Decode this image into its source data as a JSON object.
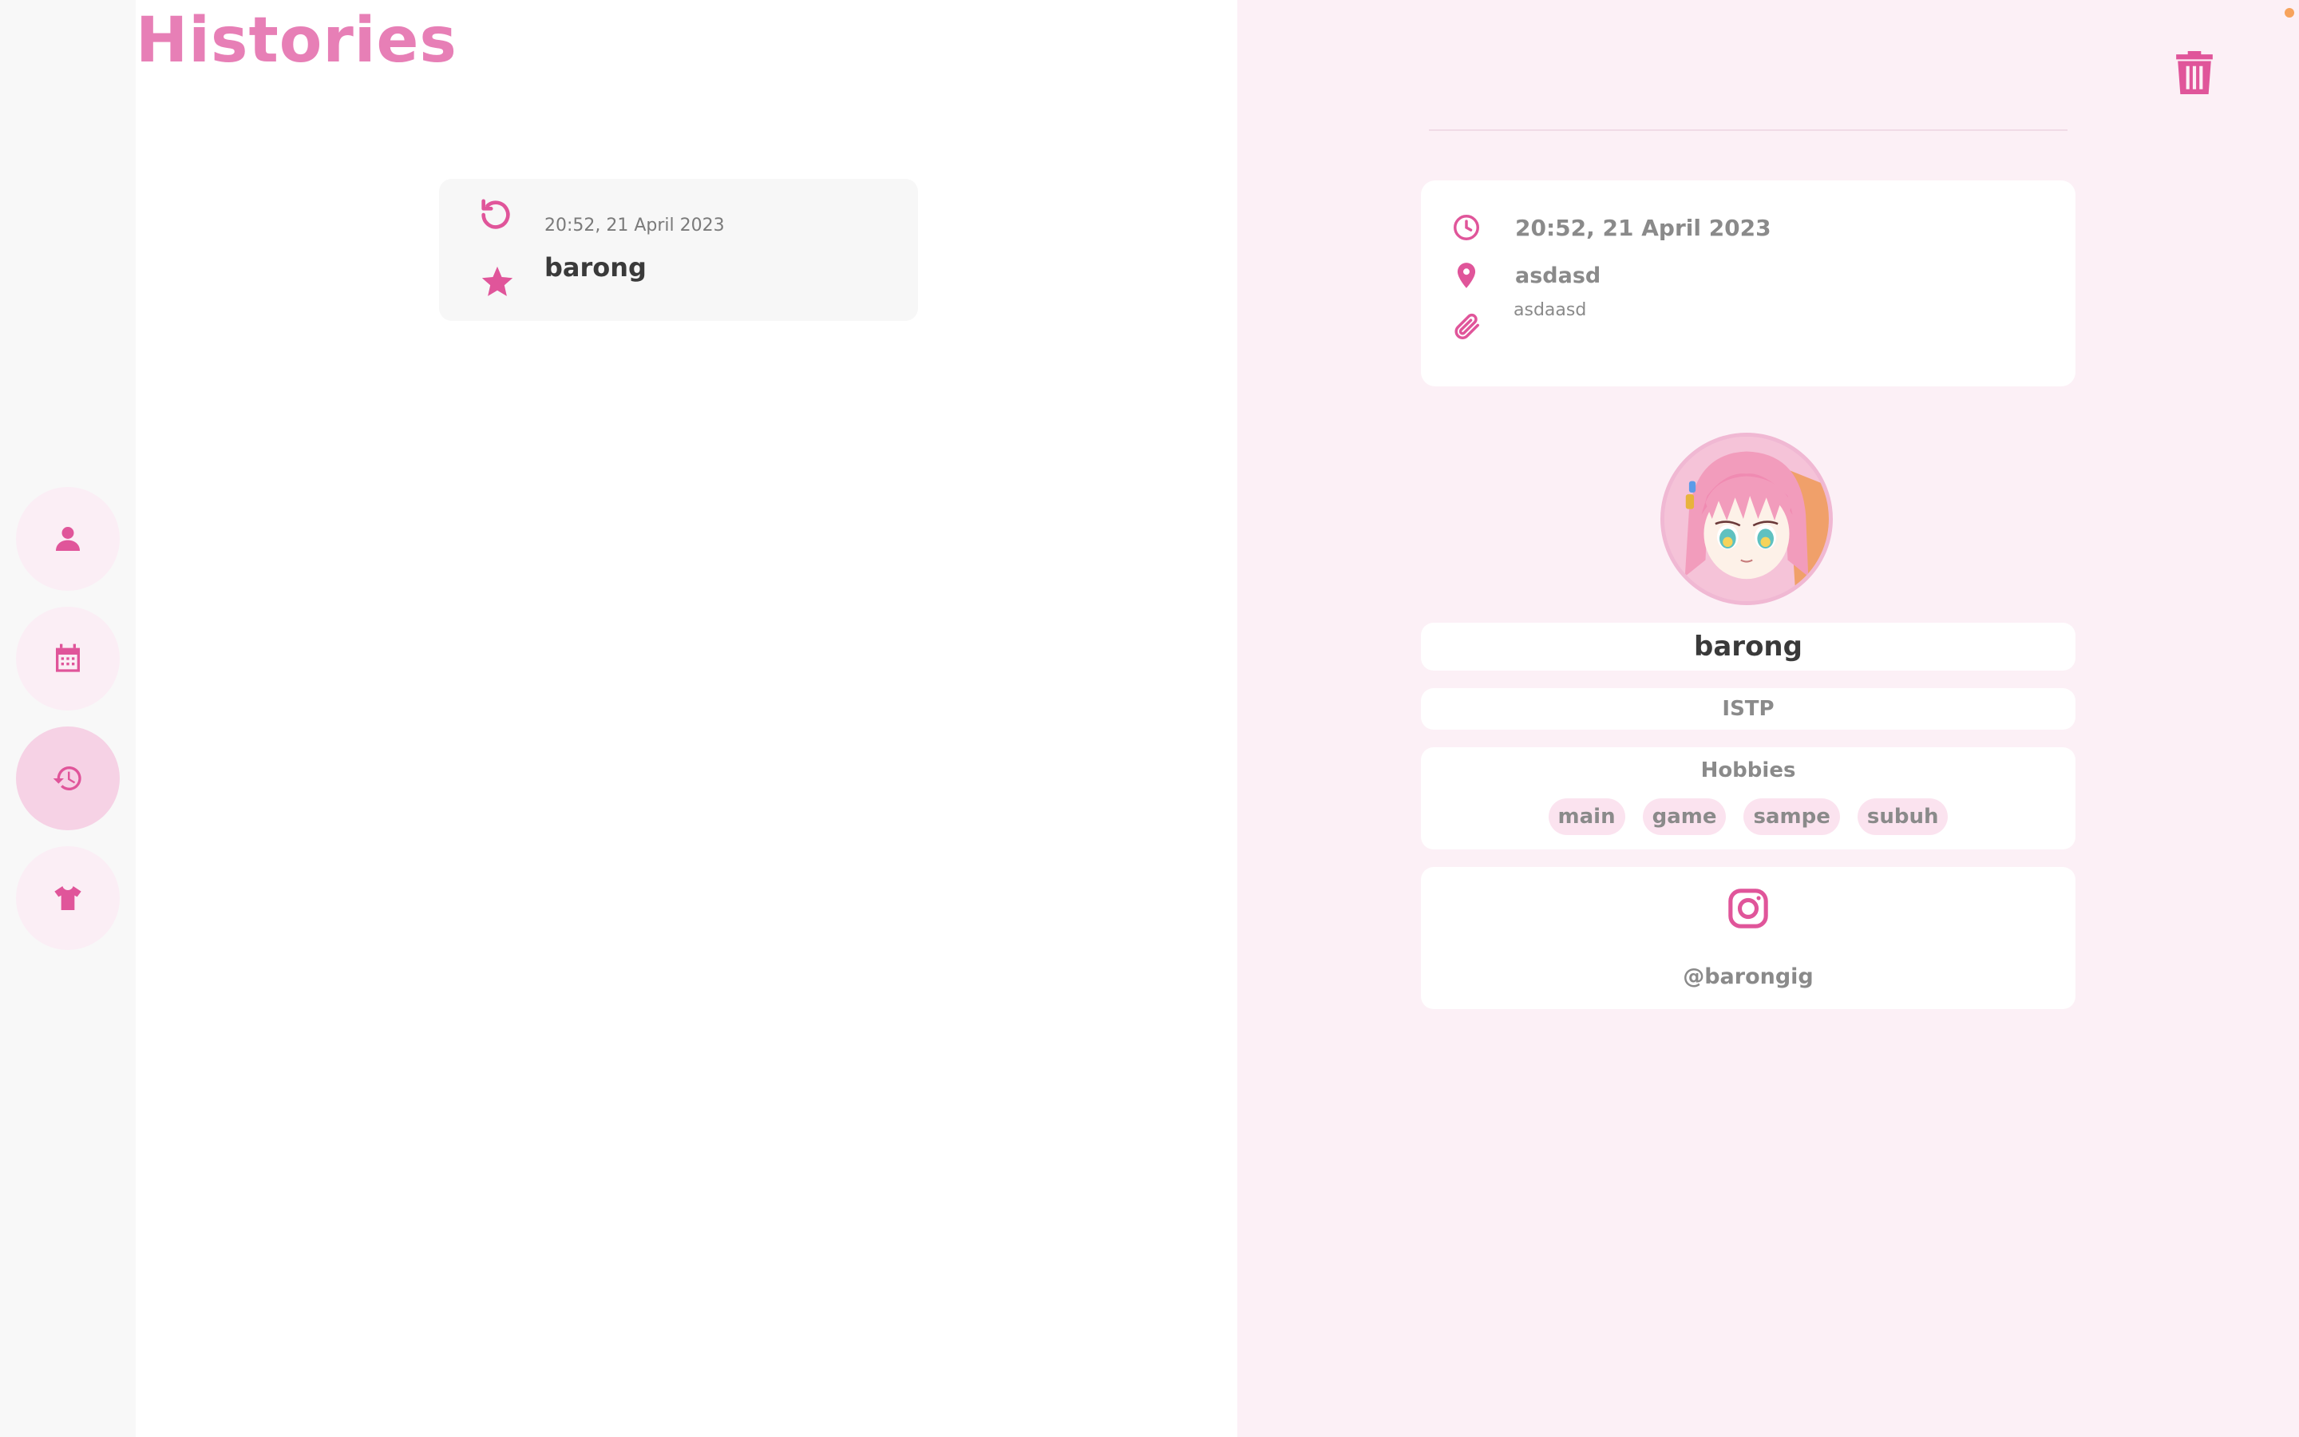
{
  "page": {
    "title": "Histories"
  },
  "colors": {
    "accent": "#e0559a",
    "title": "#e77fb6",
    "detail_bg": "#fcf0f6"
  },
  "nav": {
    "items": [
      {
        "icon": "user-icon",
        "active": false
      },
      {
        "icon": "calendar-icon",
        "active": false
      },
      {
        "icon": "history-icon",
        "active": true
      },
      {
        "icon": "shirt-icon",
        "active": false
      }
    ]
  },
  "history": {
    "items": [
      {
        "date": "20:52, 21 April 2023",
        "name": "barong"
      }
    ]
  },
  "detail": {
    "datetime": "20:52, 21 April 2023",
    "location": "asdasd",
    "attachment": "asdaasd",
    "name": "barong",
    "mbti": "ISTP",
    "hobbies_title": "Hobbies",
    "hobbies": [
      "main",
      "game",
      "sampe",
      "subuh"
    ],
    "instagram": "@barongig"
  }
}
